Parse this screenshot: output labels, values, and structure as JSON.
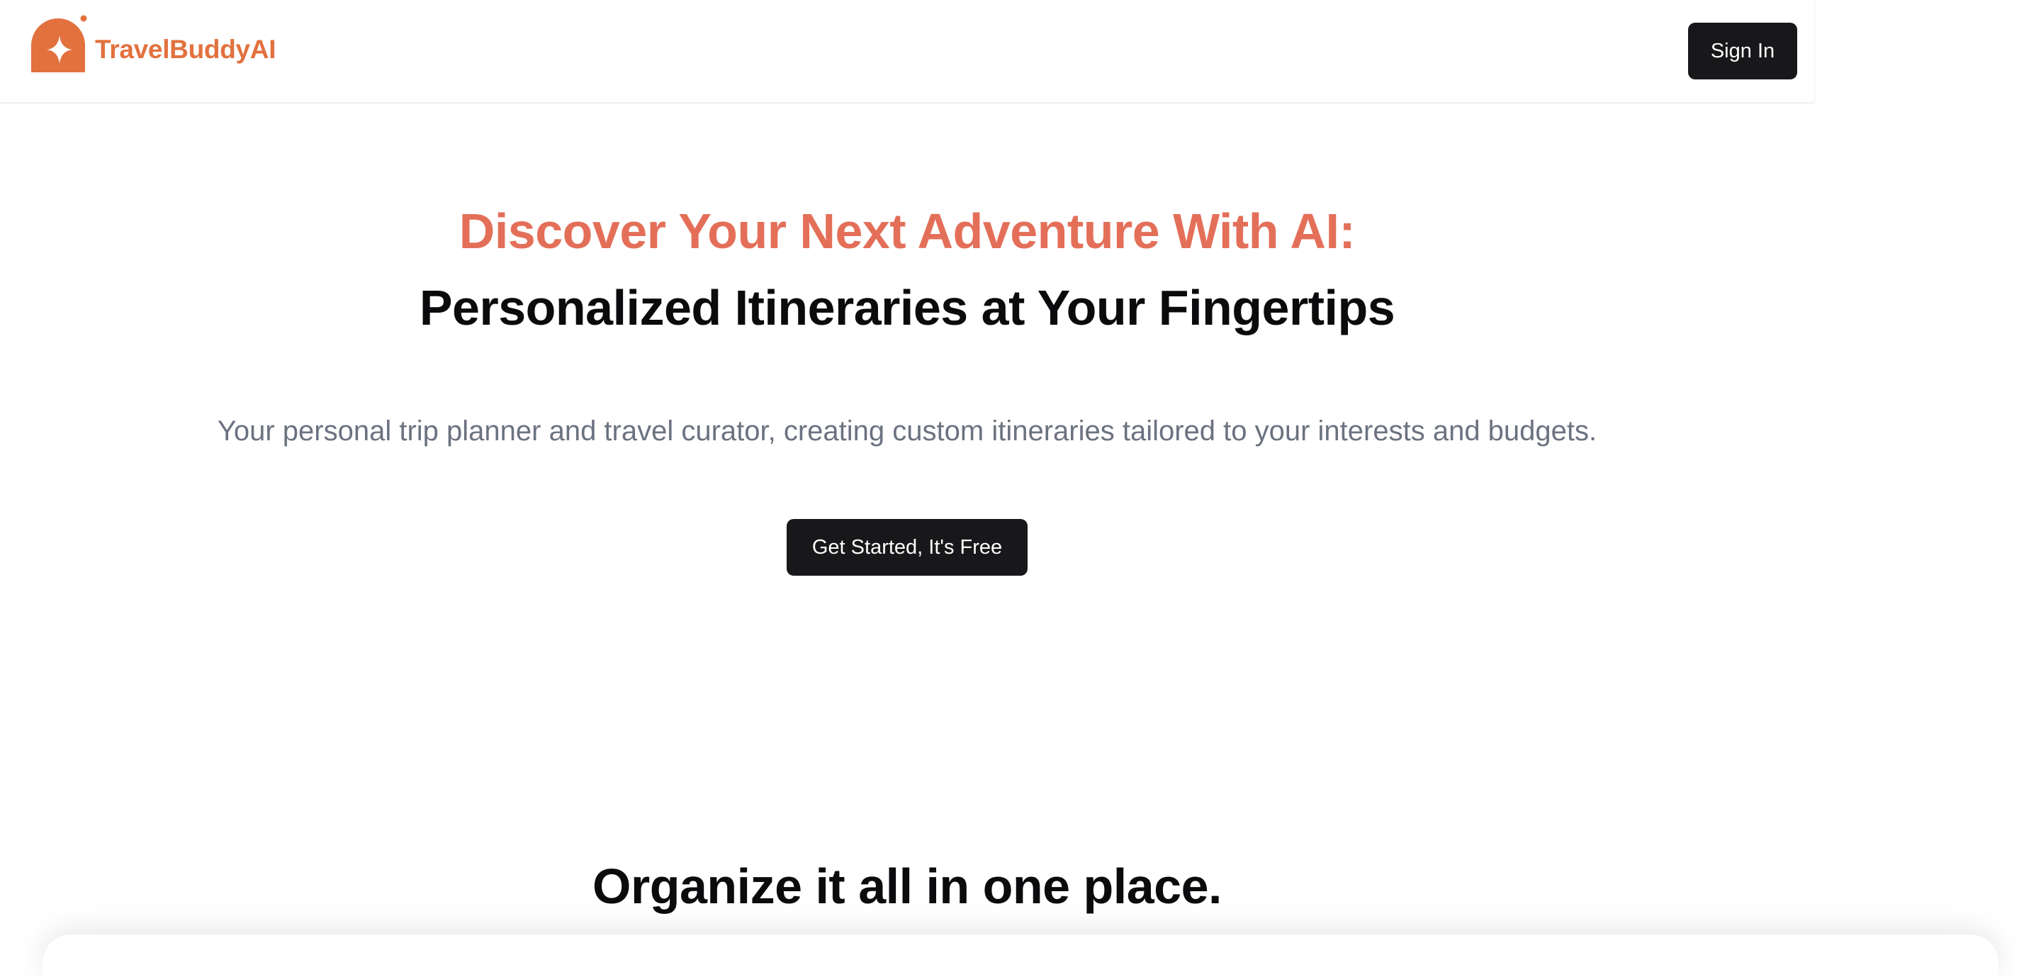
{
  "navbar": {
    "brand_name": "TravelBuddyAI",
    "logo_icon": "arch-sparkle-logo-icon",
    "signin_label": "Sign In"
  },
  "hero": {
    "headline_accent": "Discover Your Next Adventure With AI:",
    "headline_main": "Personalized Itineraries at Your Fingertips",
    "subtitle": "Your personal trip planner and travel curator, creating custom itineraries tailored to your interests and budgets.",
    "cta_label": "Get Started, It's Free"
  },
  "features": {
    "title": "Organize it all in one place."
  },
  "colors": {
    "brand": "#E2713E",
    "headline_accent": "#E46F59",
    "button_bg": "#18181b",
    "text_dark": "#0b0b0d",
    "text_muted": "#6b7280"
  }
}
